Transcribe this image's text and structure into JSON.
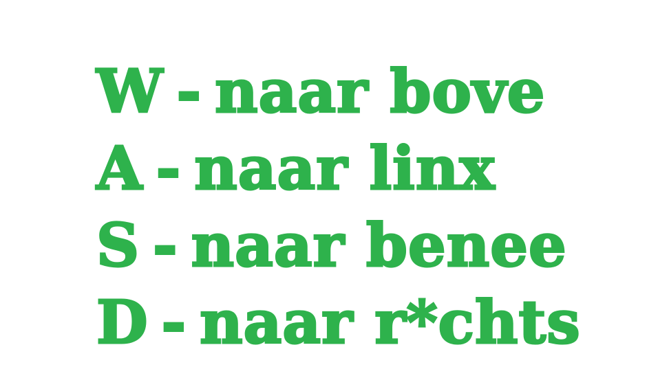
{
  "text_color": "#2eb24c",
  "background_color": "#ffffff",
  "lines": [
    {
      "key": "W",
      "dash": "-",
      "text": "naar bove"
    },
    {
      "key": "A",
      "dash": "-",
      "text": "naar linx"
    },
    {
      "key": "S",
      "dash": "-",
      "text": "naar benee"
    },
    {
      "key": "D",
      "dash": "-",
      "text": "naar r*chts"
    }
  ]
}
